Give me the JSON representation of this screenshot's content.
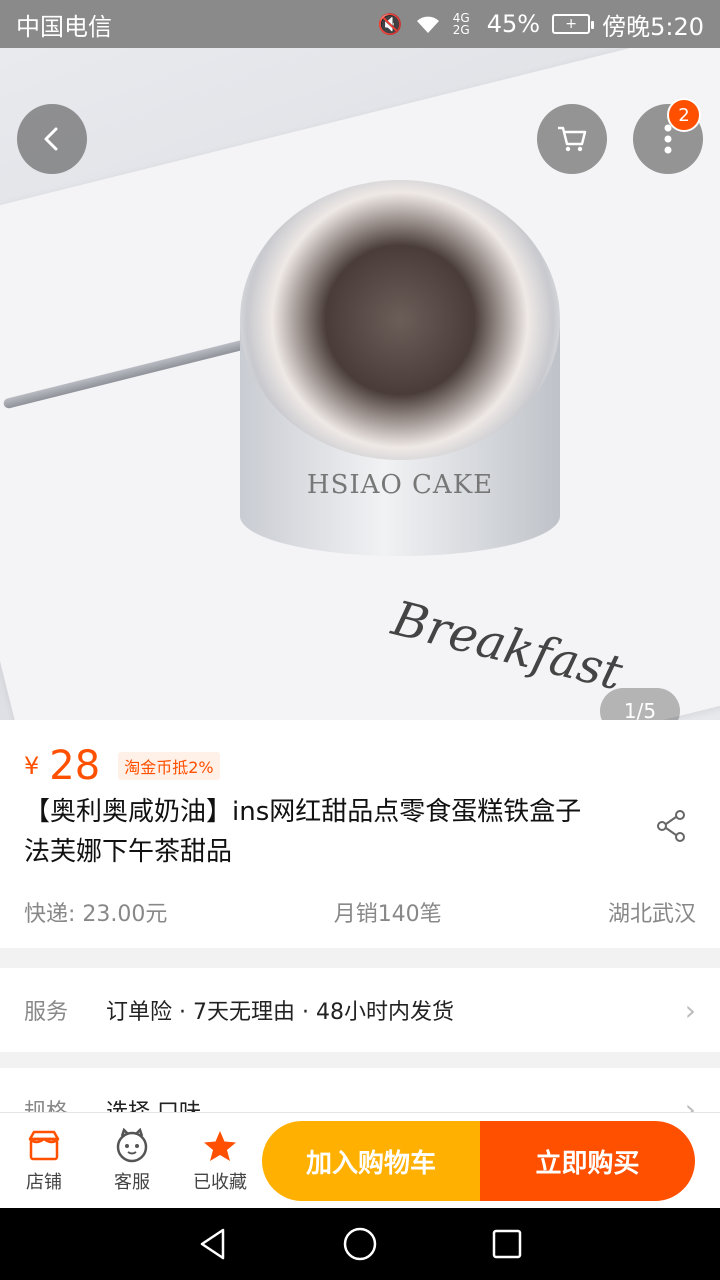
{
  "status_bar": {
    "carrier": "中国电信",
    "battery": "45%",
    "time": "傍晚5:20",
    "signal": "4G 2G"
  },
  "hero": {
    "pager": "1/5",
    "cart_badge": "2",
    "tin_label": "HSIAO CAKE",
    "tray_text": "Breakfast"
  },
  "product": {
    "price_symbol": "¥",
    "price": "28",
    "coin_tag": "淘金币抵2%",
    "title": "【奥利奥咸奶油】ins网红甜品点零食蛋糕铁盒子法芙娜下午茶甜品",
    "shipping": "快递: 23.00元",
    "sales": "月销140笔",
    "location": "湖北武汉"
  },
  "service": {
    "label": "服务",
    "text": "订单险 · 7天无理由 · 48小时内发货"
  },
  "spec": {
    "label": "规格",
    "text": "选择 口味"
  },
  "bottom_bar": {
    "shop": "店铺",
    "service": "客服",
    "favorited": "已收藏",
    "add_to_cart": "加入购物车",
    "buy_now": "立即购买"
  },
  "colors": {
    "accent": "#ff5000",
    "cart_button": "#ffb000"
  },
  "icons": [
    "back-icon",
    "cart-icon",
    "more-icon",
    "share-icon",
    "shop-icon",
    "customer-service-icon",
    "star-icon",
    "nav-back-icon",
    "nav-home-icon",
    "nav-recent-icon"
  ]
}
